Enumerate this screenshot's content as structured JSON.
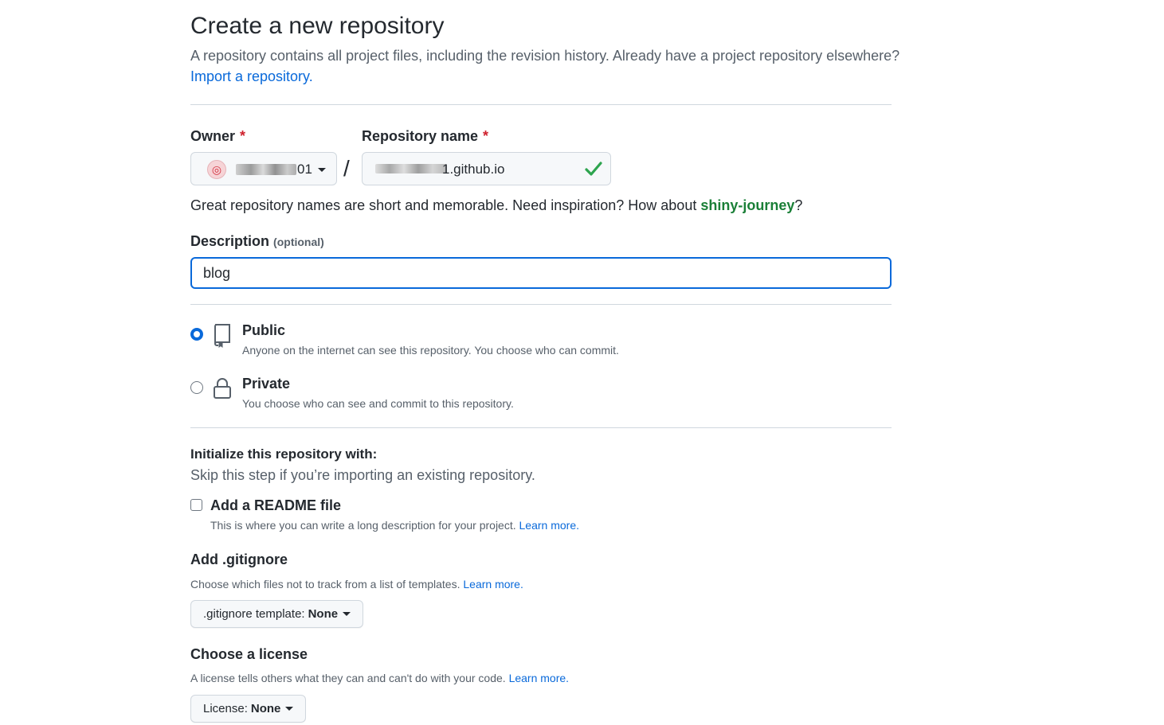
{
  "header": {
    "title": "Create a new repository",
    "subtitle": "A repository contains all project files, including the revision history. Already have a project repository elsewhere?",
    "import_link": "Import a repository."
  },
  "owner": {
    "label": "Owner",
    "required_mark": "*",
    "visible_suffix": "01"
  },
  "repo": {
    "label": "Repository name",
    "required_mark": "*",
    "visible_suffix": "1.github.io"
  },
  "name_hint": {
    "text": "Great repository names are short and memorable. Need inspiration? How about ",
    "suggestion": "shiny-journey",
    "end": "?"
  },
  "description": {
    "label": "Description",
    "optional": "(optional)",
    "value": "blog"
  },
  "visibility": {
    "public_title": "Public",
    "public_desc": "Anyone on the internet can see this repository. You choose who can commit.",
    "private_title": "Private",
    "private_desc": "You choose who can see and commit to this repository."
  },
  "init": {
    "title": "Initialize this repository with:",
    "subtitle": "Skip this step if you’re importing an existing repository.",
    "readme_label": "Add a README file",
    "readme_desc": "This is where you can write a long description for your project.",
    "learn_more": "Learn more."
  },
  "gitignore": {
    "title": "Add .gitignore",
    "desc": "Choose which files not to track from a list of templates.",
    "learn_more": "Learn more.",
    "button_prefix": ".gitignore template:",
    "button_value": "None"
  },
  "license": {
    "title": "Choose a license",
    "desc": "A license tells others what they can and can't do with your code.",
    "learn_more": "Learn more.",
    "button_prefix": "License:",
    "button_value": "None"
  },
  "colors": {
    "accent": "#0969da",
    "success": "#2da44e",
    "suggestion": "#1a7f37",
    "required": "#cf222e"
  }
}
